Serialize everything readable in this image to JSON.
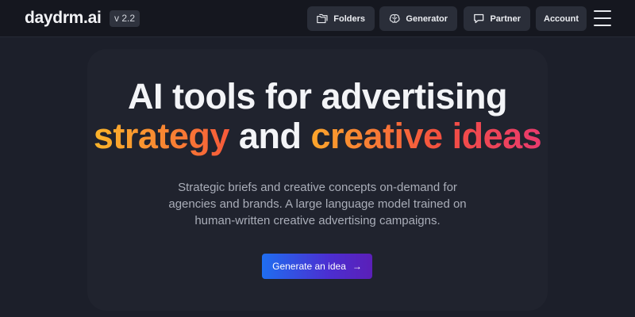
{
  "header": {
    "logo": "daydrm.ai",
    "version": "v 2.2",
    "nav": {
      "folders": "Folders",
      "generator": "Generator",
      "partner": "Partner",
      "account": "Account"
    }
  },
  "hero": {
    "headline_line1": "AI tools for advertising",
    "headline_line2_a": "strategy",
    "headline_line2_b": " and ",
    "headline_line2_c": "creative ideas",
    "subtitle_line1": "Strategic briefs and creative concepts on-demand for",
    "subtitle_line2": "agencies and brands. A large language model trained on",
    "subtitle_line3": "human-written creative advertising campaigns.",
    "cta_label": "Generate an idea",
    "cta_arrow": "→"
  },
  "colors": {
    "background": "#1c1f2a",
    "header": "#15171f",
    "nav_button": "#2a2e39",
    "gradient_start": "#fbb52a",
    "gradient_mid": "#f4513f",
    "gradient_end": "#e93a6d",
    "cta_start": "#1f6ef0",
    "cta_end": "#5b1fb8"
  },
  "icons": {
    "folders": "folders-icon",
    "generator": "brain-icon",
    "partner": "chat-bubble-icon",
    "menu": "hamburger-menu-icon"
  }
}
